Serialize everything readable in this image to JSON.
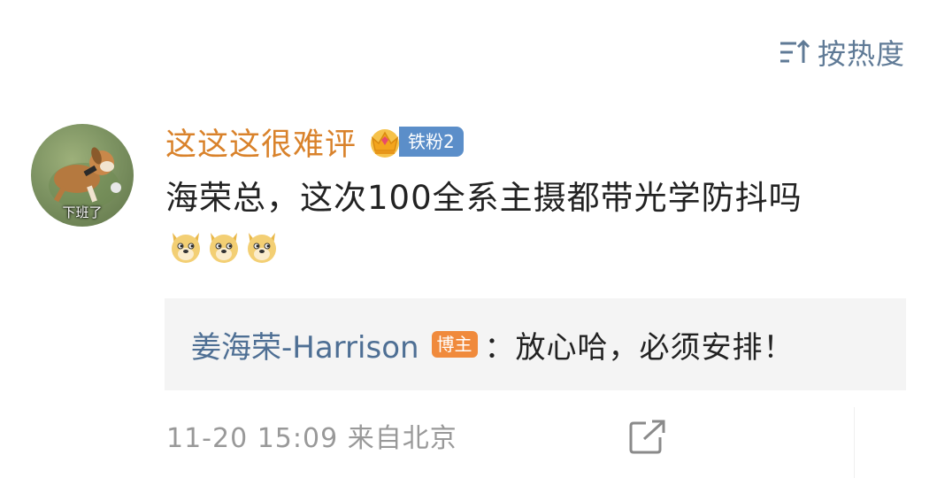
{
  "sort": {
    "label": "按热度",
    "icon": "sort-icon"
  },
  "avatar": {
    "caption": "下班了",
    "icon": "dog-avatar-image"
  },
  "comment": {
    "username": "这这这很难评",
    "fan_badge": {
      "label": "铁粉2",
      "icon": "crown-icon",
      "color": "#5b8ec9"
    },
    "text": "海荣总，这次100全系主摄都带光学防抖吗",
    "emojis": [
      "doge-icon",
      "doge-icon",
      "doge-icon"
    ],
    "username_color": "#d9822b"
  },
  "reply": {
    "author": "姜海荣-Harrison",
    "badge": "博主",
    "text": "：放心哈，必须安排！",
    "author_color": "#4e6f94",
    "badge_color": "#f08a3c"
  },
  "meta": {
    "timestamp": "11-20 15:09",
    "location": "来自北京",
    "share_icon": "share-icon"
  }
}
